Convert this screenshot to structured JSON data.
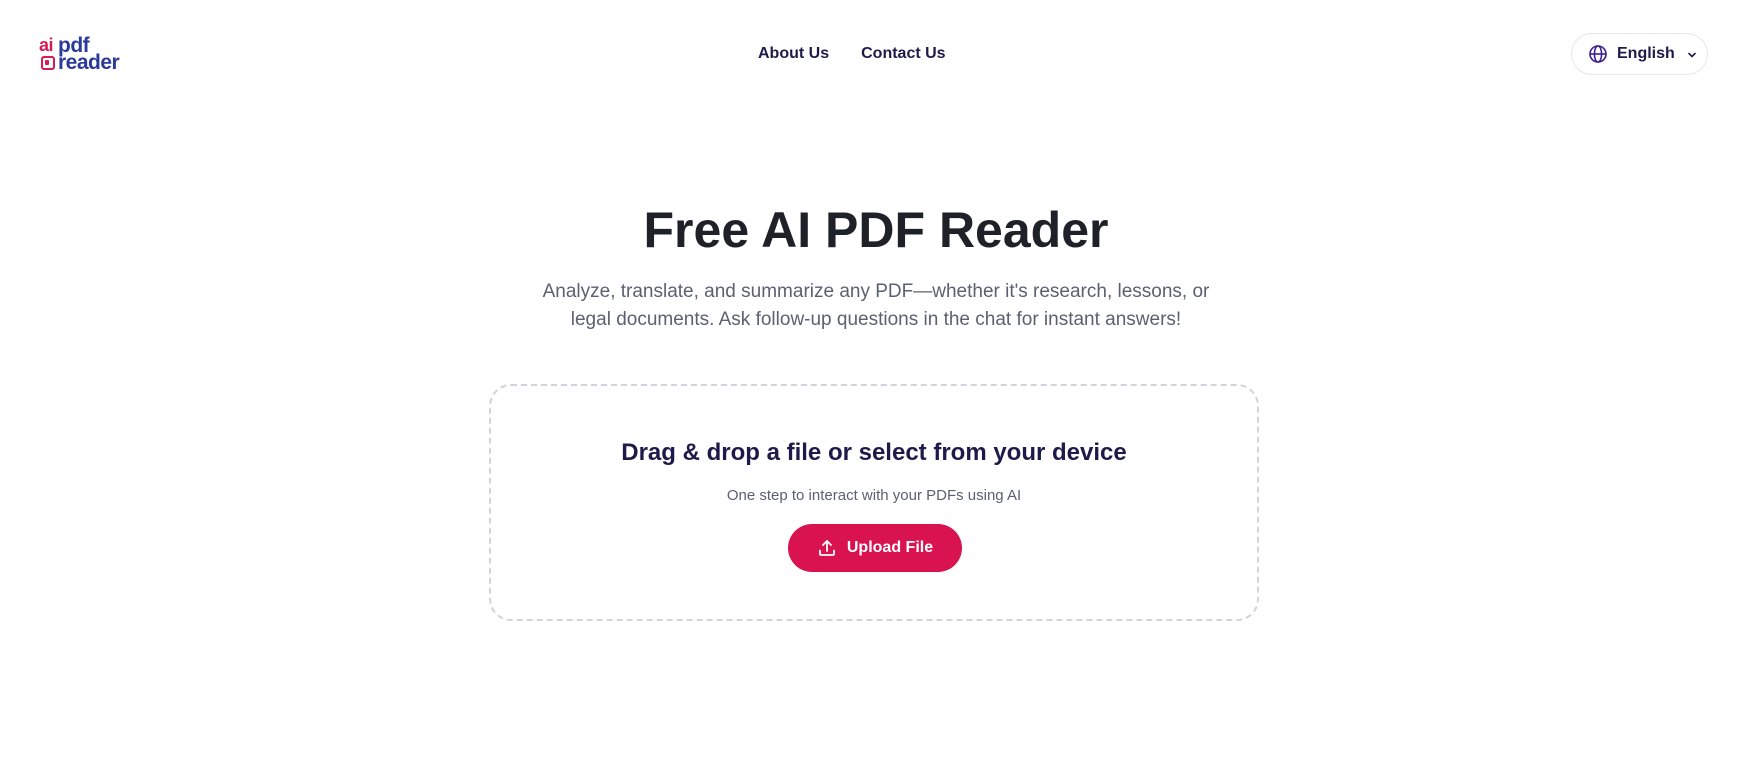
{
  "brand": {
    "logo_top_left": "ai",
    "logo_top_right": "pdf",
    "logo_bottom": "reader",
    "colors": {
      "accent_pink": "#d8134f",
      "brand_navy": "#2b3a9a",
      "nav_text": "#1e1b4b"
    }
  },
  "nav": {
    "items": [
      {
        "label": "About Us"
      },
      {
        "label": "Contact Us"
      }
    ]
  },
  "language": {
    "icon": "globe-icon",
    "selected": "English",
    "chevron_icon": "chevron-down-icon"
  },
  "hero": {
    "title": "Free AI PDF Reader",
    "subtitle": "Analyze, translate, and summarize any PDF—whether it's research, lessons, or legal documents. Ask follow-up questions in the chat for instant answers!"
  },
  "dropzone": {
    "title": "Drag & drop a file or select from your device",
    "subtitle": "One step to interact with your PDFs using AI",
    "button_label": "Upload File",
    "button_icon": "upload-icon"
  }
}
